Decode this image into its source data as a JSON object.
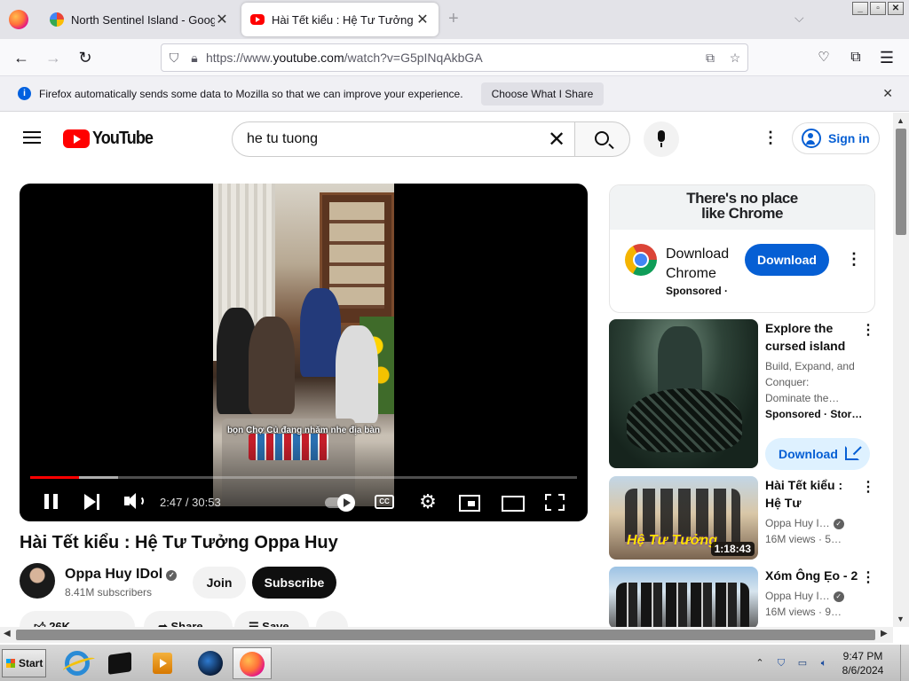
{
  "browser": {
    "tabs": [
      {
        "title": "North Sentinel Island - Google Maps",
        "active": false
      },
      {
        "title": "Hài Tết kiểu : Hệ Tư Tưởng Oppa Huy",
        "active": true
      }
    ],
    "url_prefix": "https://www.",
    "url_host": "youtube.com",
    "url_rest": "/watch?v=G5pINqAkbGA"
  },
  "notification": {
    "message": "Firefox automatically sends some data to Mozilla so that we can improve your experience.",
    "button_label": "Choose What I Share"
  },
  "youtube": {
    "logo_text": "YouTube",
    "search_query": "he tu tuong",
    "signin_label": "Sign in",
    "player": {
      "subtitle_text": "bọn Chợ Củ đang nhăm nhe địa bàn",
      "time_display": "2:47 / 30:53",
      "progress_fraction": 0.09,
      "buffered_fraction": 0.16,
      "cc_label": "CC"
    },
    "video": {
      "title": "Hài Tết kiểu : Hệ Tư Tưởng Oppa Huy",
      "channel_name": "Oppa Huy IDol",
      "subscribers": "8.41M subscribers",
      "join_label": "Join",
      "subscribe_label": "Subscribe",
      "like_count": "26K",
      "share_label": "Share",
      "save_label": "Save"
    },
    "ad": {
      "banner_line1": "There's no place",
      "banner_line2": "like Chrome",
      "title": "Download Chrome",
      "sponsored": "Sponsored · ",
      "button_label": "Download"
    },
    "recommendations": [
      {
        "title": "Explore the cursed island",
        "meta1": "Build, Expand, and",
        "meta2": "Conquer:",
        "meta3": "Dominate the…",
        "meta4": "Sponsored · Stor…",
        "button_label": "Download"
      },
      {
        "title": "Hài Tết kiểu : Hệ Tư Tưởng…",
        "channel": "Oppa Huy I…",
        "views": "16M views · 5…",
        "duration": "1:18:43",
        "thumb_text": "Hệ Tư Tưởng"
      },
      {
        "title": "Xóm Ông Ẹo - 2",
        "channel": "Oppa Huy I…",
        "views": "16M views · 9…"
      }
    ]
  },
  "taskbar": {
    "start_label": "Start",
    "time": "9:47 PM",
    "date": "8/6/2024"
  },
  "colors": {
    "yt_red": "#ff0000",
    "yt_blue": "#065fd4",
    "firefox_blue": "#0060df"
  }
}
